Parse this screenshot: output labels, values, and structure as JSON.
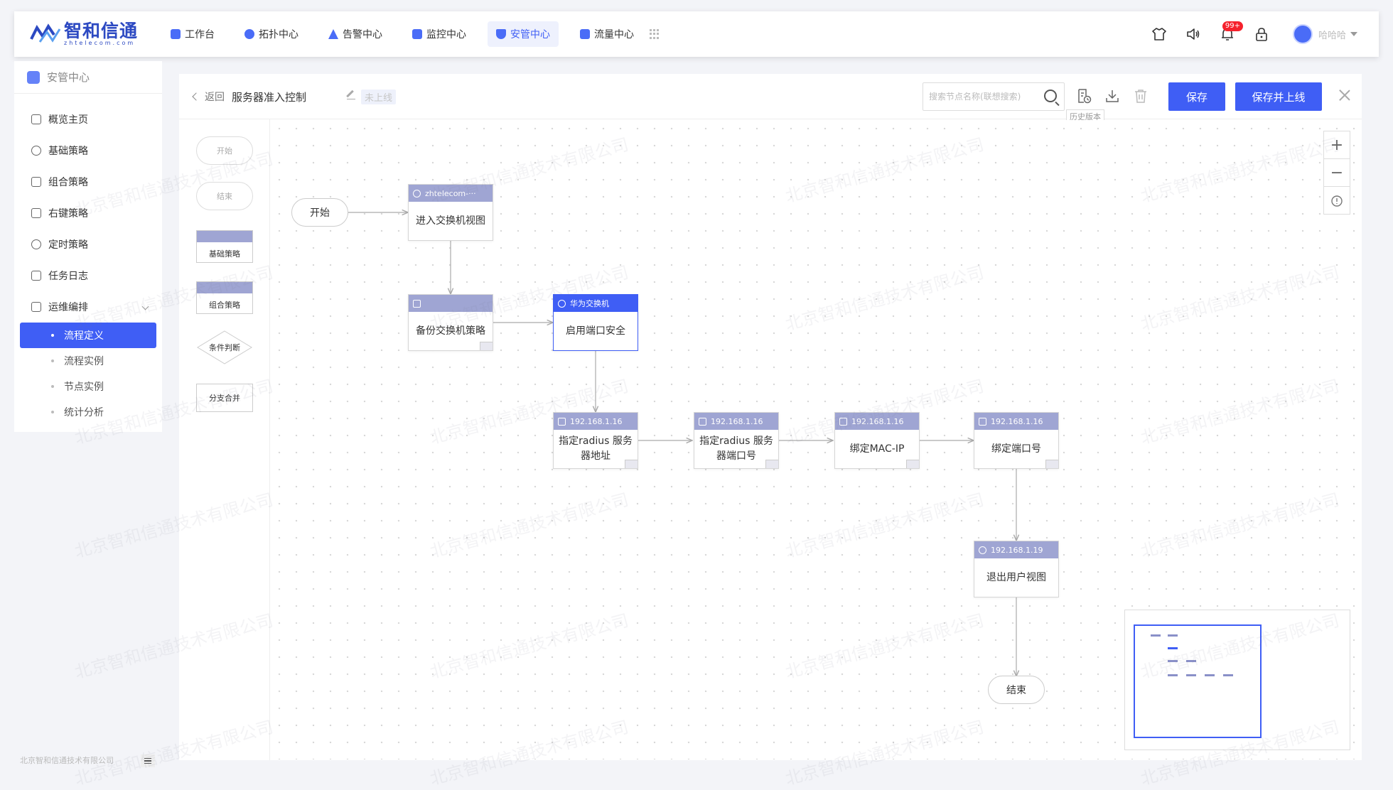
{
  "header": {
    "logo_text": "智和信通",
    "logo_sub": "zhtelecom.com",
    "nav": [
      {
        "label": "工作台"
      },
      {
        "label": "拓扑中心"
      },
      {
        "label": "告警中心"
      },
      {
        "label": "监控中心"
      },
      {
        "label": "安管中心"
      },
      {
        "label": "流量中心"
      }
    ],
    "notification_badge": "99+",
    "username": "哈哈哈"
  },
  "sidebar": {
    "title": "安管中心",
    "items": [
      {
        "label": "概览主页"
      },
      {
        "label": "基础策略"
      },
      {
        "label": "组合策略"
      },
      {
        "label": "右键策略"
      },
      {
        "label": "定时策略"
      },
      {
        "label": "任务日志"
      },
      {
        "label": "运维编排"
      }
    ],
    "sub_items": [
      {
        "label": "流程定义"
      },
      {
        "label": "流程实例"
      },
      {
        "label": "节点实例"
      },
      {
        "label": "统计分析"
      }
    ],
    "footer": "北京智和信通技术有限公司"
  },
  "toolbar": {
    "back": "返回",
    "title": "服务器准入控制",
    "status": "未上线",
    "search_placeholder": "搜索节点名称(联想搜索)",
    "history_tip": "历史版本",
    "save": "保存",
    "save_publish": "保存并上线"
  },
  "palette": {
    "start": "开始",
    "end": "结束",
    "basic": "基础策略",
    "combo": "组合策略",
    "condition": "条件判断",
    "merge": "分支合并"
  },
  "flow": {
    "start": "开始",
    "end": "结束",
    "nodes": [
      {
        "head": "zhtelecom-···",
        "body": "进入交换机视图"
      },
      {
        "head": "",
        "body": "备份交换机策略"
      },
      {
        "head": "华为交换机",
        "body": "启用端口安全"
      },
      {
        "head": "192.168.1.16",
        "body": "指定radius 服务器地址"
      },
      {
        "head": "192.168.1.16",
        "body": "指定radius 服务器端口号"
      },
      {
        "head": "192.168.1.16",
        "body": "绑定MAC-IP"
      },
      {
        "head": "192.168.1.16",
        "body": "绑定端口号"
      },
      {
        "head": "192.168.1.19",
        "body": "退出用户视图"
      }
    ]
  },
  "watermark": "北京智和信通技术有限公司",
  "colors": {
    "accent": "#3f5ef5",
    "node_head": "#9fa5d3",
    "badge": "#f5222d"
  }
}
